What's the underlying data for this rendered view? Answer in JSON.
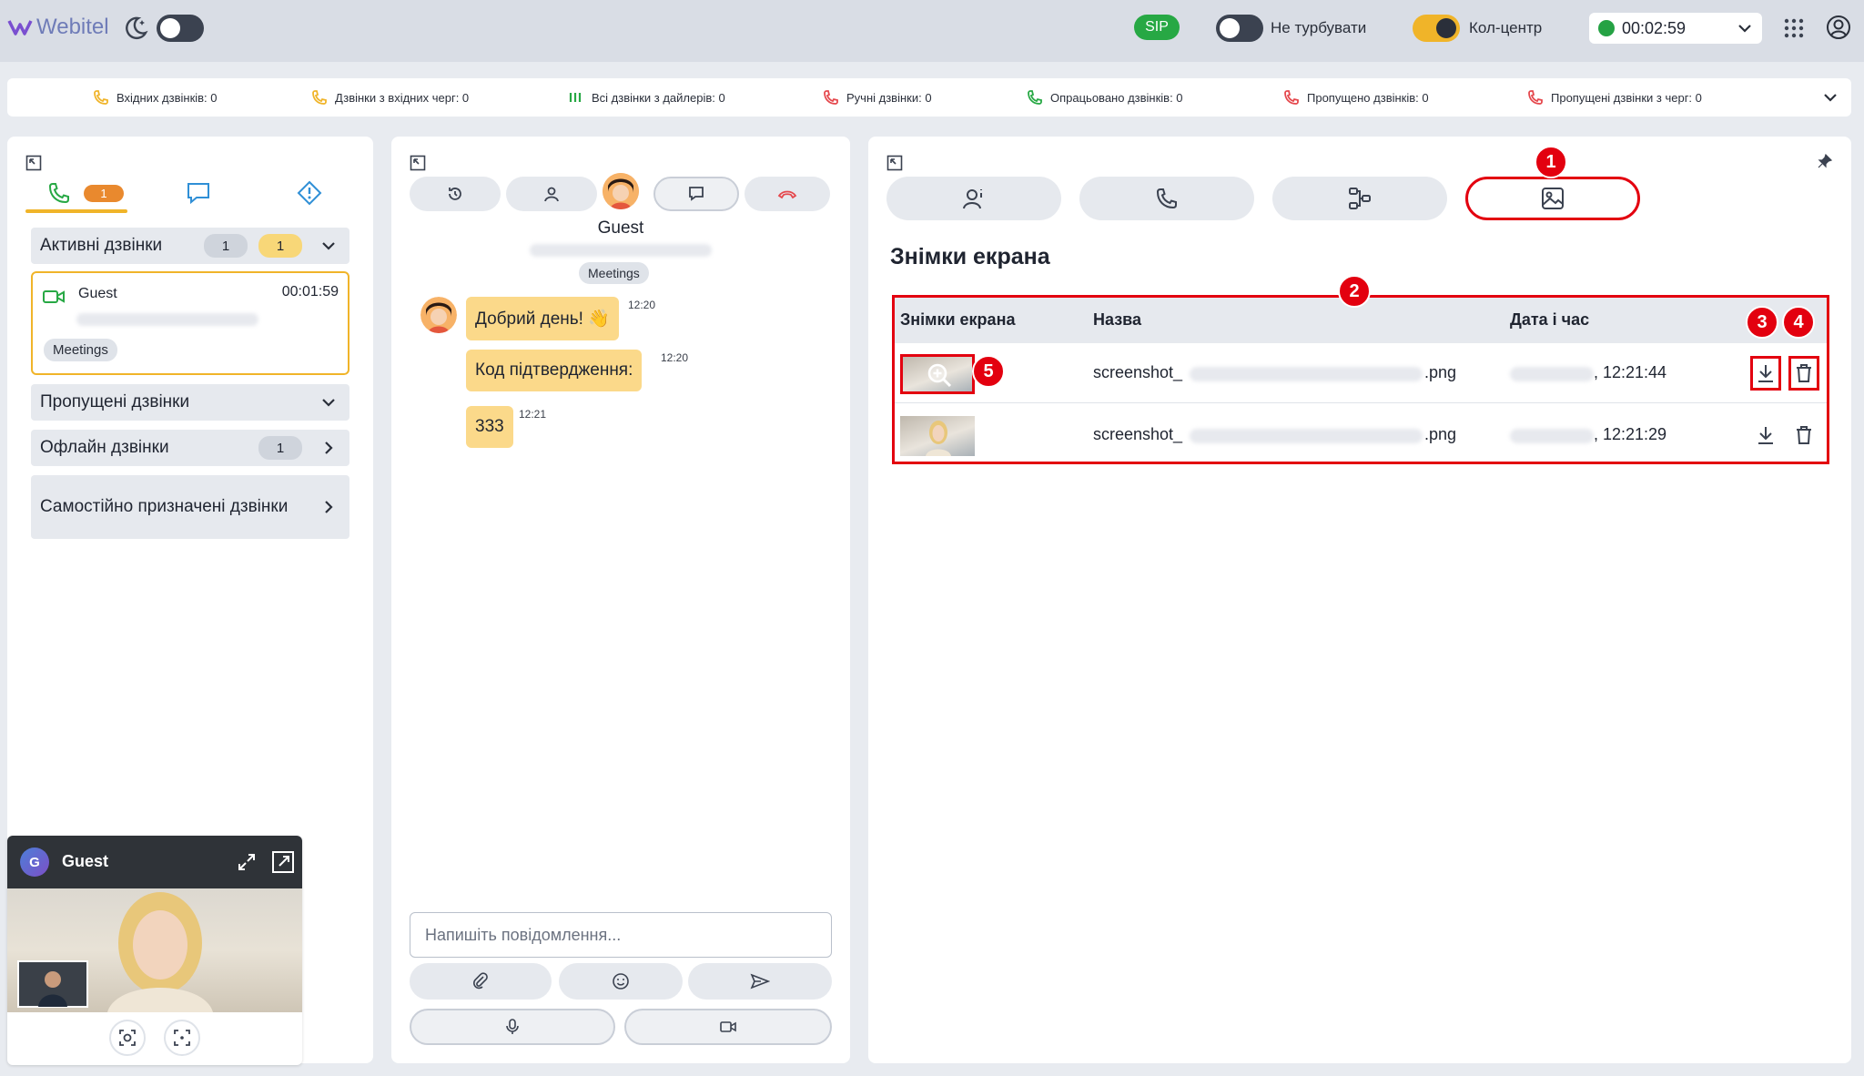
{
  "app": {
    "brand": "Webitel"
  },
  "topbar": {
    "sip_label": "SIP",
    "dnd_label": "Не турбувати",
    "callcenter_label": "Кол-центр",
    "status_time": "00:02:59"
  },
  "stats": [
    {
      "label": "Вхідних дзвінків: 0",
      "color": "#f0b429"
    },
    {
      "label": "Дзвінки з вхідних черг: 0",
      "color": "#f0b429"
    },
    {
      "label": "Всі дзвінки з дайлерів: 0",
      "color": "#27a844"
    },
    {
      "label": "Ручні дзвінки: 0",
      "color": "#27a844"
    },
    {
      "label": "Опрацьовано дзвінків: 0",
      "color": "#27a844"
    },
    {
      "label": "Пропущено дзвінків: 0",
      "color": "#e5484d"
    },
    {
      "label": "Пропущені дзвінки з черг: 0",
      "color": "#e5484d"
    }
  ],
  "left": {
    "calls_badge": "1",
    "active_calls": {
      "label": "Активні дзвінки",
      "count_grey": "1",
      "count_yellow": "1"
    },
    "card": {
      "name": "Guest",
      "timer": "00:01:59",
      "tag": "Meetings"
    },
    "missed": {
      "label": "Пропущені дзвінки"
    },
    "offline": {
      "label": "Офлайн дзвінки",
      "count": "1"
    },
    "self_assigned": {
      "label": "Самостійно призначені дзвінки"
    }
  },
  "video": {
    "avatar_letter": "G",
    "name": "Guest"
  },
  "middle": {
    "guest_name": "Guest",
    "tag": "Meetings",
    "messages": [
      {
        "text": "Добрий день! 👋",
        "time": "12:20"
      },
      {
        "text": "Код підтвердження:",
        "time": "12:20"
      },
      {
        "text": "333",
        "time": "12:21"
      }
    ],
    "input_placeholder": "Напишіть повідомлення..."
  },
  "right": {
    "section_title": "Знімки екрана",
    "table": {
      "headers": [
        "Знімки екрана",
        "Назва",
        "Дата і час"
      ],
      "rows": [
        {
          "name_prefix": "screenshot_",
          "name_suffix": ".png",
          "time": ", 12:21:44"
        },
        {
          "name_prefix": "screenshot_",
          "name_suffix": ".png",
          "time": ", 12:21:29"
        }
      ]
    },
    "markers": [
      "1",
      "2",
      "3",
      "4",
      "5"
    ]
  },
  "colors": {
    "accent": "#f0b429",
    "highlight": "#e3000f",
    "success": "#27a844"
  }
}
